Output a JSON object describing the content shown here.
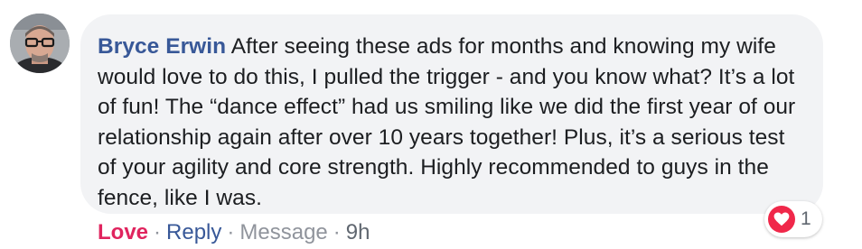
{
  "comment": {
    "author": "Bryce Erwin",
    "text": "After seeing these ads for months and knowing my wife would love to do this, I pulled the trigger - and you know what? It’s a lot of fun! The “dance effect” had us smiling like we did the first year of our relationship again after over 10 years together! Plus, it’s a serious test of your agility and core strength. Highly recommended to guys in the fence, like I was."
  },
  "actions": {
    "love": "Love",
    "reply": "Reply",
    "message": "Message",
    "separator": "·",
    "timestamp": "9h"
  },
  "reactions": {
    "icon": "heart-icon",
    "count": "1"
  },
  "colors": {
    "author": "#385898",
    "love": "#e0245e",
    "heart": "#f0284a",
    "bubble": "#f2f3f5"
  }
}
